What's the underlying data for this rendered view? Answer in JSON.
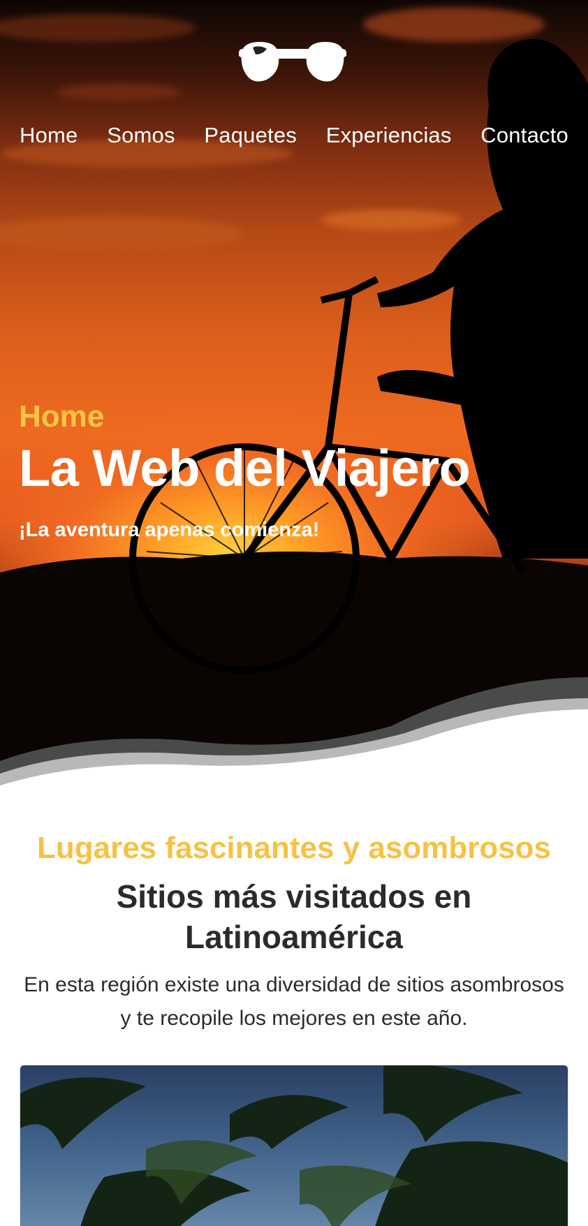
{
  "nav": {
    "items": [
      "Home",
      "Somos",
      "Paquetes",
      "Experiencias",
      "Contacto"
    ]
  },
  "hero": {
    "eyebrow": "Home",
    "title": "La Web del Viajero",
    "tagline": "¡La aventura apenas comienza!"
  },
  "featured": {
    "eyebrow": "Lugares fascinantes y asombrosos",
    "title": "Sitios más visitados en Latinoamérica",
    "description": "En esta región existe una diversidad de sitios asombrosos y te recopile los mejores en este año."
  },
  "colors": {
    "accent": "#f6c244",
    "wave_dark": "#4a4a4a",
    "wave_light": "#b8b8b8"
  },
  "icons": {
    "logo": "sunglasses-icon"
  }
}
